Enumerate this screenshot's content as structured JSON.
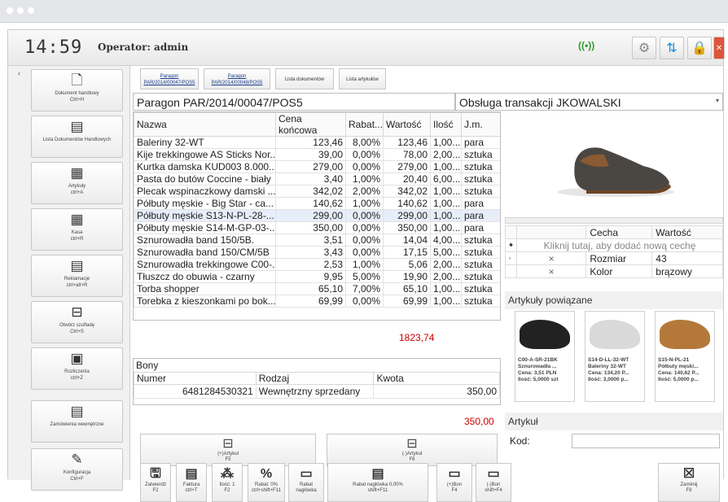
{
  "header": {
    "clock": "14:59",
    "operator": "Operator: admin"
  },
  "sidebar": [
    {
      "label": "Dokument handlowy",
      "key": "Ctrl+H",
      "icon": "document-icon",
      "glyph": "🗋"
    },
    {
      "label": "Lista Dokumentów Handlowych",
      "key": "",
      "icon": "list-icon",
      "glyph": "▤"
    },
    {
      "label": "Artykuły",
      "key": "ctrl+A",
      "icon": "grid-icon",
      "glyph": "▦"
    },
    {
      "label": "Kasa",
      "key": "ctrl+R",
      "icon": "calculator-icon",
      "glyph": "▦"
    },
    {
      "label": "Reklamacje",
      "key": "ctrl+alt+R",
      "icon": "complaint-icon",
      "glyph": "▤"
    },
    {
      "label": "Otwórz szufladę",
      "key": "Ctrl+S",
      "icon": "drawer-icon",
      "glyph": "⊟"
    },
    {
      "label": "Rozliczenia",
      "key": "ctrl+Z",
      "icon": "settlement-icon",
      "glyph": "▣"
    },
    {
      "label": "Zamówienia wewnętrzne",
      "key": "",
      "icon": "order-icon",
      "glyph": "▤"
    },
    {
      "label": "Konfiguracja",
      "key": "Ctrl+F",
      "icon": "wrench-icon",
      "glyph": "✎"
    }
  ],
  "tabs": [
    {
      "line1": "Paragon",
      "line2": "PAR/2014/00047/POS5"
    },
    {
      "line1": "Paragon",
      "line2": "PAR/2014/00048/POS5"
    },
    {
      "line1": "Lista dokumentów",
      "line2": ""
    },
    {
      "line1": "Lista artykułów",
      "line2": ""
    }
  ],
  "doc": {
    "label": "Paragon",
    "number": "PAR/2014/00047/POS5",
    "service_label": "Obsługa transakcji",
    "service_value": "JKOWALSKI"
  },
  "columns": [
    "Nazwa",
    "Cena końcowa",
    "Rabat...",
    "Wartość",
    "Ilość",
    "J.m."
  ],
  "rows": [
    [
      "Baleriny 32-WT",
      "123,46",
      "8,00%",
      "123,46",
      "1,00...",
      "para"
    ],
    [
      "Kije trekkingowe AS Sticks Nor...",
      "39,00",
      "0,00%",
      "78,00",
      "2,00...",
      "sztuka"
    ],
    [
      "Kurtka damska KUD003 8.000...",
      "279,00",
      "0,00%",
      "279,00",
      "1,00...",
      "sztuka"
    ],
    [
      "Pasta do butów Coccine - biały",
      "3,40",
      "1,00%",
      "20,40",
      "6,00...",
      "sztuka"
    ],
    [
      "Plecak wspinaczkowy damski ...",
      "342,02",
      "2,00%",
      "342,02",
      "1,00...",
      "sztuka"
    ],
    [
      "Półbuty męskie - Big Star - ca...",
      "140,62",
      "1,00%",
      "140,62",
      "1,00...",
      "para"
    ],
    [
      "Półbuty męskie S13-N-PL-28-...",
      "299,00",
      "0,00%",
      "299,00",
      "1,00...",
      "para"
    ],
    [
      "Półbuty męskie S14-M-GP-03-...",
      "350,00",
      "0,00%",
      "350,00",
      "1,00...",
      "para"
    ],
    [
      "Sznurowadła band 150/5B.",
      "3,51",
      "0,00%",
      "14,04",
      "4,00...",
      "sztuka"
    ],
    [
      "Sznurowadła band 150/CM/5B",
      "3,43",
      "0,00%",
      "17,15",
      "5,00...",
      "sztuka"
    ],
    [
      "Sznurowadła trekkingowe C00-...",
      "2,53",
      "1,00%",
      "5,06",
      "2,00...",
      "sztuka"
    ],
    [
      "Tłuszcz do obuwia - czarny",
      "9,95",
      "5,00%",
      "19,90",
      "2,00...",
      "sztuka"
    ],
    [
      "Torba shopper",
      "65,10",
      "7,00%",
      "65,10",
      "1,00...",
      "sztuka"
    ],
    [
      "Torebka z kieszonkami po bok...",
      "69,99",
      "0,00%",
      "69,99",
      "1,00...",
      "sztuka"
    ]
  ],
  "selected_row": 6,
  "total": "1823,74",
  "bony": {
    "title": "Bony",
    "cols": [
      "Numer",
      "Rodzaj",
      "Kwota"
    ],
    "row": [
      "6481284530321",
      "Wewnętrzny sprzedany",
      "350,00"
    ],
    "total": "350,00"
  },
  "cecha": {
    "cols": [
      "Cecha",
      "Wartość"
    ],
    "add": "Kliknij tutaj, aby dodać nową cechę",
    "rows": [
      [
        "Rozmiar",
        "43"
      ],
      [
        "Kolor",
        "brązowy"
      ]
    ]
  },
  "related_title": "Artykuły powiązane",
  "related": [
    {
      "code": "C00-A-SR-21BK",
      "name": "Sznurowadła ...",
      "price": "Cena: 3,51 PLN",
      "qty": "Ilość: 5,0000 szt",
      "color": "#222"
    },
    {
      "code": "S14-D-LL-32-WT",
      "name": "Baleriny 32-WT",
      "price": "Cena: 134,20 P...",
      "qty": "Ilość: 3,0000 p...",
      "color": "#d9d9d9"
    },
    {
      "code": "S15-N-PL-21",
      "name": "Półbuty męski...",
      "price": "Cena: 140,62 P...",
      "qty": "Ilość: 5,0000 p...",
      "color": "#b4793a"
    }
  ],
  "artykul": {
    "title": "Artykuł",
    "kod": "Kod:"
  },
  "mid_buttons": [
    {
      "label": "(+)Artykuł",
      "key": "F5"
    },
    {
      "label": "(-)Artykuł",
      "key": "F6"
    }
  ],
  "bottom": [
    {
      "label": "Zatwierdź",
      "key": "F2",
      "icon": "save-icon",
      "glyph": "🖫"
    },
    {
      "label": "Faktura",
      "key": "ctrl+T",
      "icon": "invoice-icon",
      "glyph": "▤"
    },
    {
      "label": "Ilość: 1",
      "key": "F2",
      "icon": "quantity-icon",
      "glyph": "⁂"
    },
    {
      "label": "Rabat: 0%",
      "key": "ctrl+shift+F11",
      "icon": "percent-icon",
      "glyph": "%"
    },
    {
      "label": "Rabat",
      "key": "nagłówka",
      "icon": "discount-header-icon",
      "glyph": "▭"
    },
    {
      "label": "Rabat nagłówka 0,00%",
      "key": "shift+F11",
      "icon": "header-discount-icon",
      "glyph": "▤"
    },
    {
      "label": "(+)Bon",
      "key": "F4",
      "icon": "add-voucher-icon",
      "glyph": "▭"
    },
    {
      "label": "(-)Bon",
      "key": "shift+F4",
      "icon": "remove-voucher-icon",
      "glyph": "▭"
    },
    {
      "label": "Zamknij",
      "key": "F9",
      "icon": "close-icon",
      "glyph": "☒"
    }
  ]
}
